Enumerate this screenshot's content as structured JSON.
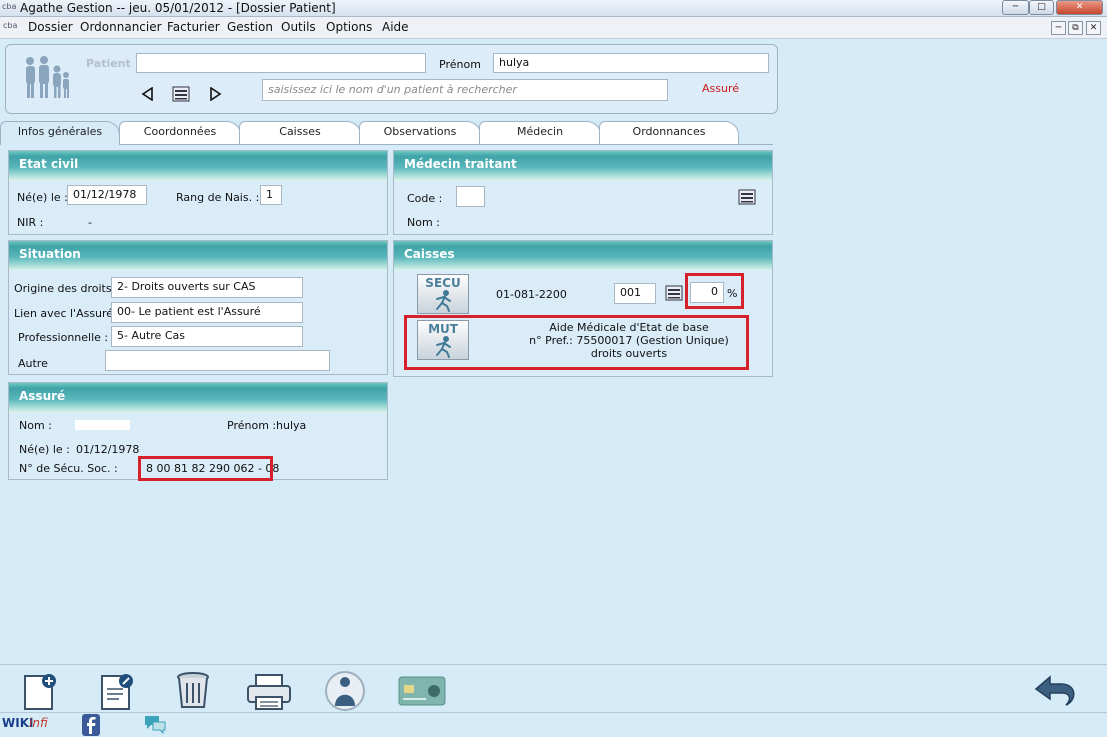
{
  "window": {
    "title": "Agathe Gestion    --  jeu. 05/01/2012  - [Dossier Patient]",
    "app_icon_text": "cba"
  },
  "menu": [
    "Dossier",
    "Ordonnancier",
    "Facturier",
    "Gestion",
    "Outils",
    "Options",
    "Aide"
  ],
  "patient": {
    "label_patient": "Patient",
    "patient_value": "",
    "label_prenom": "Prénom",
    "prenom_value": "hulya",
    "search_placeholder": "saisissez ici le nom d'un patient à rechercher",
    "assure_label": "Assuré"
  },
  "tabs": [
    "Infos générales",
    "Coordonnées",
    "Caisses",
    "Observations",
    "Médecin",
    "Ordonnances"
  ],
  "etat_civil": {
    "title": "Etat civil",
    "ne_le_label": "Né(e) le :",
    "ne_le_value": "01/12/1978",
    "rang_label": "Rang de Nais. :",
    "rang_value": "1",
    "nir_label": "NIR :",
    "nir_value": "-"
  },
  "medecin_traitant": {
    "title": "Médecin traitant",
    "code_label": "Code :",
    "code_value": "",
    "nom_label": "Nom :"
  },
  "situation": {
    "title": "Situation",
    "origine_label": "Origine des droits :",
    "origine_value": "2- Droits ouverts sur CAS",
    "lien_label": "Lien avec l'Assuré :",
    "lien_value": "00- Le patient est l'Assuré",
    "pro_label": "Professionnelle :",
    "pro_value": "5- Autre Cas",
    "autre_label": "Autre",
    "autre_value": ""
  },
  "caisses": {
    "title": "Caisses",
    "secu_caption": "SECU",
    "secu_code": "01-081-2200",
    "secu_center": "001",
    "secu_percent": "0",
    "percent_sign": "%",
    "mut_caption": "MUT",
    "mut_line1": "Aide Médicale d'Etat de base",
    "mut_line2": "n° Pref.: 75500017 (Gestion Unique)",
    "mut_line3": "droits ouverts"
  },
  "assure": {
    "title": "Assuré",
    "nom_label": "Nom :",
    "prenom_label": "Prénom :",
    "prenom_value": "hulya",
    "ne_le_label": "Né(e) le :",
    "ne_le_value": "01/12/1978",
    "secu_label": "N° de Sécu. Soc. :",
    "secu_value": "8 00 81 82 290 062 - 08"
  },
  "toolbar_icons": [
    "new-document-icon",
    "edit-document-icon",
    "trash-icon",
    "printer-icon",
    "patient-icon",
    "vitale-card-icon",
    "back-arrow-icon"
  ],
  "status": {
    "wiki_label": "WIKI",
    "wiki_suffix": "infi"
  },
  "colors": {
    "background": "#d6ebf8",
    "header_teal": "#3fa3a7",
    "highlight_red": "#d6202a",
    "assure_red": "#cc1a1a"
  }
}
